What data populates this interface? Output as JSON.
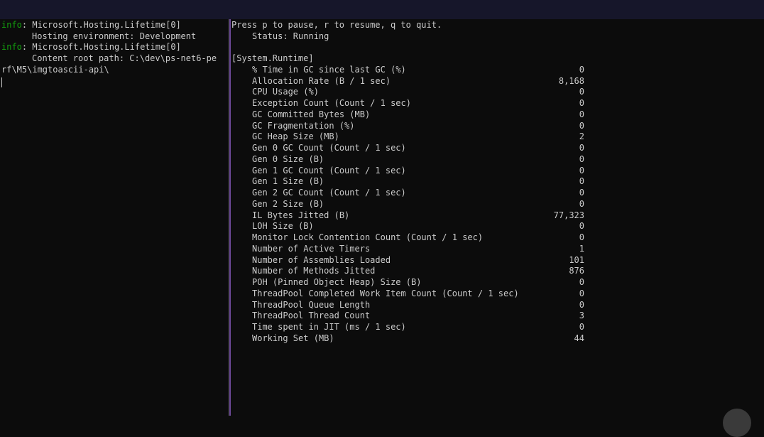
{
  "left_pane": {
    "lines": [
      {
        "tag": "info",
        "text": ": Microsoft.Hosting.Lifetime[0]"
      },
      {
        "tag": "",
        "text": "Hosting environment: Development"
      },
      {
        "tag": "info",
        "text": ": Microsoft.Hosting.Lifetime[0]"
      },
      {
        "tag": "",
        "text": "Content root path: C:\\dev\\ps-net6-pe"
      },
      {
        "tag": "",
        "text": "rf\\M5\\imgtoascii-api\\"
      }
    ]
  },
  "right_pane": {
    "instructions": "Press p to pause, r to resume, q to quit.",
    "status": "Status: Running",
    "provider": "[System.Runtime]",
    "metrics": [
      {
        "name": "% Time in GC since last GC (%)",
        "value": "0"
      },
      {
        "name": "Allocation Rate (B / 1 sec)",
        "value": "8,168"
      },
      {
        "name": "CPU Usage (%)",
        "value": "0"
      },
      {
        "name": "Exception Count (Count / 1 sec)",
        "value": "0"
      },
      {
        "name": "GC Committed Bytes (MB)",
        "value": "0"
      },
      {
        "name": "GC Fragmentation (%)",
        "value": "0"
      },
      {
        "name": "GC Heap Size (MB)",
        "value": "2"
      },
      {
        "name": "Gen 0 GC Count (Count / 1 sec)",
        "value": "0"
      },
      {
        "name": "Gen 0 Size (B)",
        "value": "0"
      },
      {
        "name": "Gen 1 GC Count (Count / 1 sec)",
        "value": "0"
      },
      {
        "name": "Gen 1 Size (B)",
        "value": "0"
      },
      {
        "name": "Gen 2 GC Count (Count / 1 sec)",
        "value": "0"
      },
      {
        "name": "Gen 2 Size (B)",
        "value": "0"
      },
      {
        "name": "IL Bytes Jitted (B)",
        "value": "77,323"
      },
      {
        "name": "LOH Size (B)",
        "value": "0"
      },
      {
        "name": "Monitor Lock Contention Count (Count / 1 sec)",
        "value": "0"
      },
      {
        "name": "Number of Active Timers",
        "value": "1"
      },
      {
        "name": "Number of Assemblies Loaded",
        "value": "101"
      },
      {
        "name": "Number of Methods Jitted",
        "value": "876"
      },
      {
        "name": "POH (Pinned Object Heap) Size (B)",
        "value": "0"
      },
      {
        "name": "ThreadPool Completed Work Item Count (Count / 1 sec)",
        "value": "0"
      },
      {
        "name": "ThreadPool Queue Length",
        "value": "0"
      },
      {
        "name": "ThreadPool Thread Count",
        "value": "3"
      },
      {
        "name": "Time spent in JIT (ms / 1 sec)",
        "value": "0"
      },
      {
        "name": "Working Set (MB)",
        "value": "44"
      }
    ]
  },
  "colors": {
    "background": "#0c0c0c",
    "text": "#cccccc",
    "info_tag": "#13a10e",
    "pane_divider_accent": "#6e4a9a",
    "top_bar": "#16162a"
  }
}
